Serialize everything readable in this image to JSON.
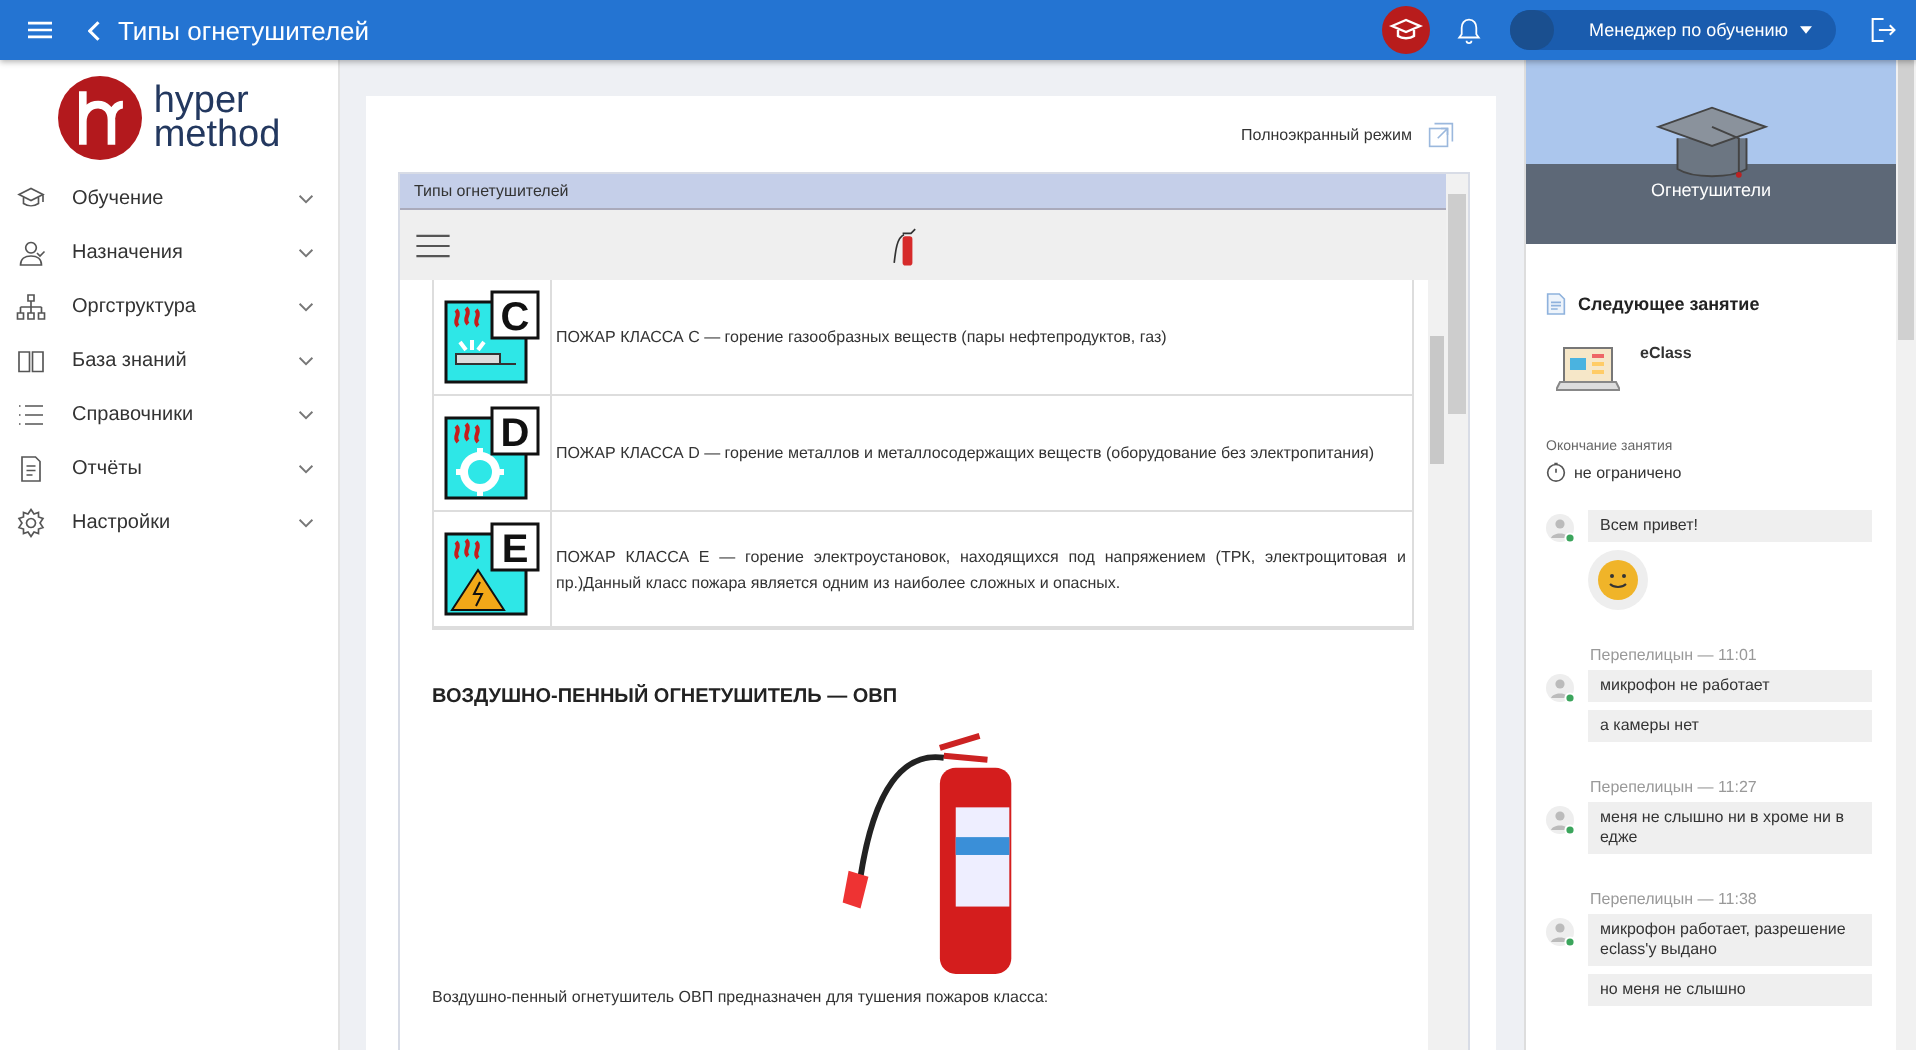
{
  "topbar": {
    "title": "Типы огнетушителей",
    "user": "Менеджер по обучению"
  },
  "logo": {
    "line1": "hyper",
    "line2": "method"
  },
  "sidebar": {
    "items": [
      {
        "label": "Обучение"
      },
      {
        "label": "Назначения"
      },
      {
        "label": "Оргструктура"
      },
      {
        "label": "База знаний"
      },
      {
        "label": "Справочники"
      },
      {
        "label": "Отчёты"
      },
      {
        "label": "Настройки"
      }
    ]
  },
  "content": {
    "fullscreen_label": "Полноэкранный режим",
    "frame_title": "Типы огнетушителей",
    "fire_classes": [
      {
        "kind": "gas",
        "letter": "C",
        "text": "ПОЖАР КЛАССА C — горение газообразных веществ (пары нефтепродуктов, газ)"
      },
      {
        "kind": "metal",
        "letter": "D",
        "text": "ПОЖАР КЛАССА D — горение металлов и металлосодержащих веществ (оборудование без электропитания)"
      },
      {
        "kind": "electric",
        "letter": "E",
        "text": "ПОЖАР КЛАССА E — горение электроустановок, находящихся под напряжением (ТРК, электрощитовая и пр.)Данный класс пожара является одним из наиболее сложных и опасных."
      }
    ],
    "heading": "ВОЗДУШНО-ПЕННЫЙ ОГНЕТУШИТЕЛЬ — ОВП",
    "paragraph": "Воздушно-пенный огнетушитель ОВП предназначен для тушения пожаров класса:"
  },
  "course_panel": {
    "title": "Огнетушители",
    "next_label": "Следующее занятие",
    "lesson": "eClass",
    "end_label": "Окончание занятия",
    "end_value": "не ограничено"
  },
  "chat": [
    {
      "messages": [
        {
          "kind": "text",
          "text": "Всем привет!"
        },
        {
          "kind": "emoji"
        }
      ]
    },
    {
      "header": "Перепелицын — 11:01",
      "messages": [
        {
          "kind": "text",
          "text": "микрофон не работает"
        },
        {
          "kind": "text",
          "text": "а камеры нет"
        }
      ]
    },
    {
      "header": "Перепелицын — 11:27",
      "messages": [
        {
          "kind": "text",
          "text": "меня не слышно ни в хроме ни в едже"
        }
      ]
    },
    {
      "header": "Перепелицын — 11:38",
      "messages": [
        {
          "kind": "text",
          "text": "микрофон работает, разрешение eclass'у выдано"
        },
        {
          "kind": "text",
          "text": "но меня не слышно"
        }
      ]
    }
  ]
}
